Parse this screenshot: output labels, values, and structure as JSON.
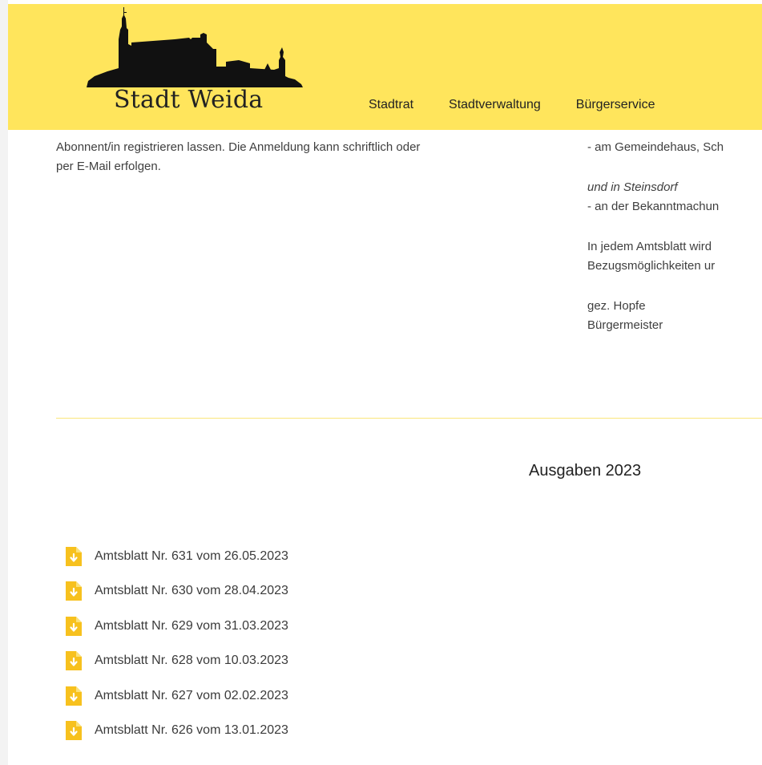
{
  "header": {
    "brand": "Stadt Weida",
    "nav": [
      {
        "label": "Stadtrat"
      },
      {
        "label": "Stadtverwaltung"
      },
      {
        "label": "Bürgerservice"
      }
    ],
    "accent_color": "#ffe55c"
  },
  "main": {
    "left_lines": [
      "Abonnent/in registrieren lassen. Die Anmeldung kann schriftlich oder",
      "per E-Mail erfolgen."
    ],
    "right_lines": {
      "line1": "- am Gemeindehaus, Sch",
      "line2_italic": "und in Steinsdorf",
      "line3": "- an der Bekanntmachun",
      "line4": "In jedem Amtsblatt wird",
      "line5": "Bezugsmöglichkeiten ur",
      "signature_name": "gez. Hopfe",
      "signature_title": "Bürgermeister"
    },
    "section_title": "Ausgaben 2023",
    "documents": [
      {
        "label": "Amtsblatt Nr. 631 vom 26.05.2023",
        "icon": "file-download-icon"
      },
      {
        "label": "Amtsblatt Nr. 630 vom 28.04.2023",
        "icon": "file-download-icon"
      },
      {
        "label": "Amtsblatt Nr. 629 vom 31.03.2023",
        "icon": "file-download-icon"
      },
      {
        "label": "Amtsblatt Nr. 628 vom 10.03.2023",
        "icon": "file-download-icon"
      },
      {
        "label": "Amtsblatt Nr. 627 vom 02.02.2023",
        "icon": "file-download-icon"
      },
      {
        "label": "Amtsblatt Nr. 626 vom 13.01.2023",
        "icon": "file-download-icon"
      }
    ]
  }
}
